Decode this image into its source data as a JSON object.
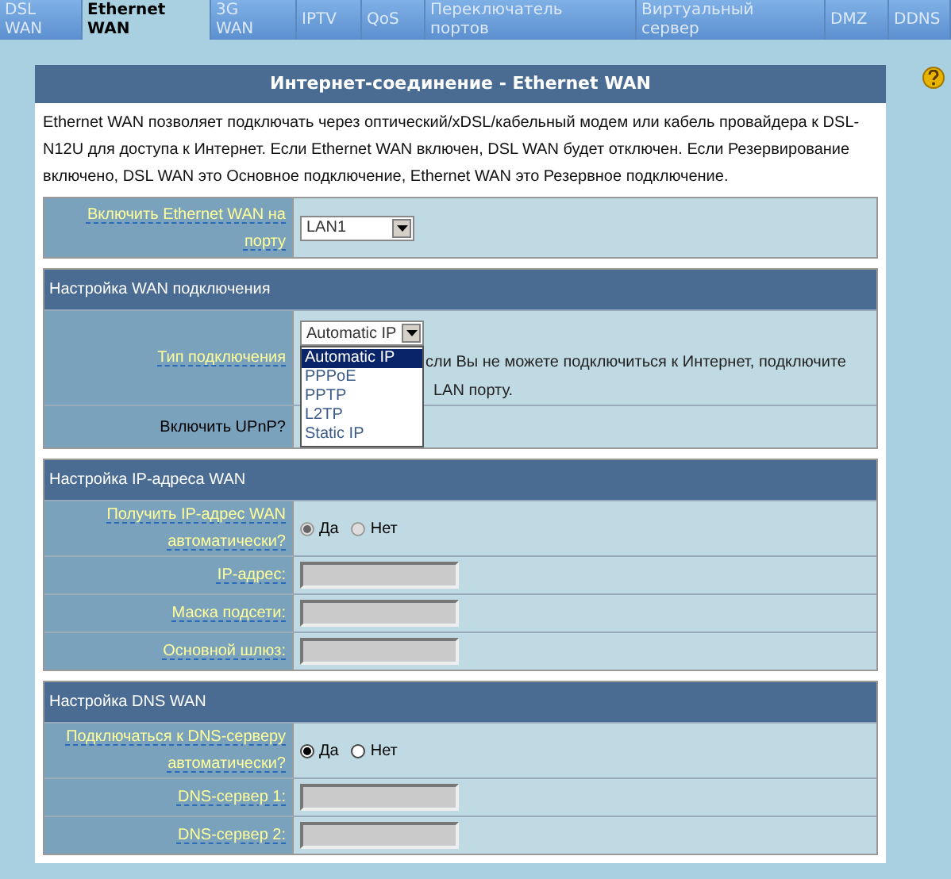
{
  "tabs": [
    {
      "label": "DSL WAN",
      "selected": false
    },
    {
      "label": "Ethernet WAN",
      "selected": true
    },
    {
      "label": "3G WAN",
      "selected": false
    },
    {
      "label": "IPTV",
      "selected": false
    },
    {
      "label": "QoS",
      "selected": false
    },
    {
      "label": "Переключатель портов",
      "selected": false
    },
    {
      "label": "Виртуальный сервер",
      "selected": false
    },
    {
      "label": "DMZ",
      "selected": false
    },
    {
      "label": "DDNS",
      "selected": false
    }
  ],
  "panel": {
    "title": "Интернет-соединение - Ethernet WAN",
    "description": "Ethernet WAN позволяет подключать через оптический/xDSL/кабельный модем или кабель провайдера к DSL-N12U для доступа к Интернет. Если Ethernet WAN включен, DSL WAN будет отключен. Если Резервирование включено, DSL WAN это Основное подключение, Ethernet WAN это Резервное подключение."
  },
  "sections": [
    {
      "rows": [
        {
          "kind": "select",
          "label": "Включить Ethernet WAN на порту",
          "link": true,
          "value": "LAN1",
          "expanded": false
        }
      ]
    },
    {
      "title": "Настройка WAN подключения",
      "rows": [
        {
          "kind": "select",
          "label": "Тип подключения",
          "link": true,
          "value": "Automatic IP",
          "expanded": true,
          "options": [
            {
              "label": "Automatic IP",
              "selected": true
            },
            {
              "label": "PPPoE",
              "selected": false
            },
            {
              "label": "PPTP",
              "selected": false
            },
            {
              "label": "L2TP",
              "selected": false
            },
            {
              "label": "Static IP",
              "selected": false
            }
          ],
          "hint": [
            "сли Вы не можете подключиться к Интернет, подключите",
            "LAN порту."
          ]
        },
        {
          "kind": "plain",
          "label": "Включить UPnP?",
          "link": false
        }
      ]
    },
    {
      "title": "Настройка IP-адреса WAN",
      "rows": [
        {
          "kind": "radio",
          "label": "Получить IP-адрес WAN автоматически?",
          "link": true,
          "disabled": true,
          "options": [
            {
              "label": "Да",
              "selected": true
            },
            {
              "label": "Нет",
              "selected": false
            }
          ]
        },
        {
          "kind": "input",
          "label": "IP-адрес:",
          "link": true,
          "disabled": true
        },
        {
          "kind": "input",
          "label": "Маска подсети:",
          "link": true,
          "disabled": true
        },
        {
          "kind": "input",
          "label": "Основной шлюз:",
          "link": true,
          "disabled": true
        }
      ]
    },
    {
      "title": "Настройка DNS WAN",
      "rows": [
        {
          "kind": "radio",
          "label": "Подключаться к DNS-серверу автоматически?",
          "link": true,
          "disabled": false,
          "options": [
            {
              "label": "Да",
              "selected": true
            },
            {
              "label": "Нет",
              "selected": false
            }
          ]
        },
        {
          "kind": "input",
          "label": "DNS-сервер 1:",
          "link": true,
          "disabled": true
        },
        {
          "kind": "input",
          "label": "DNS-сервер 2:",
          "link": true,
          "disabled": true
        }
      ]
    }
  ]
}
